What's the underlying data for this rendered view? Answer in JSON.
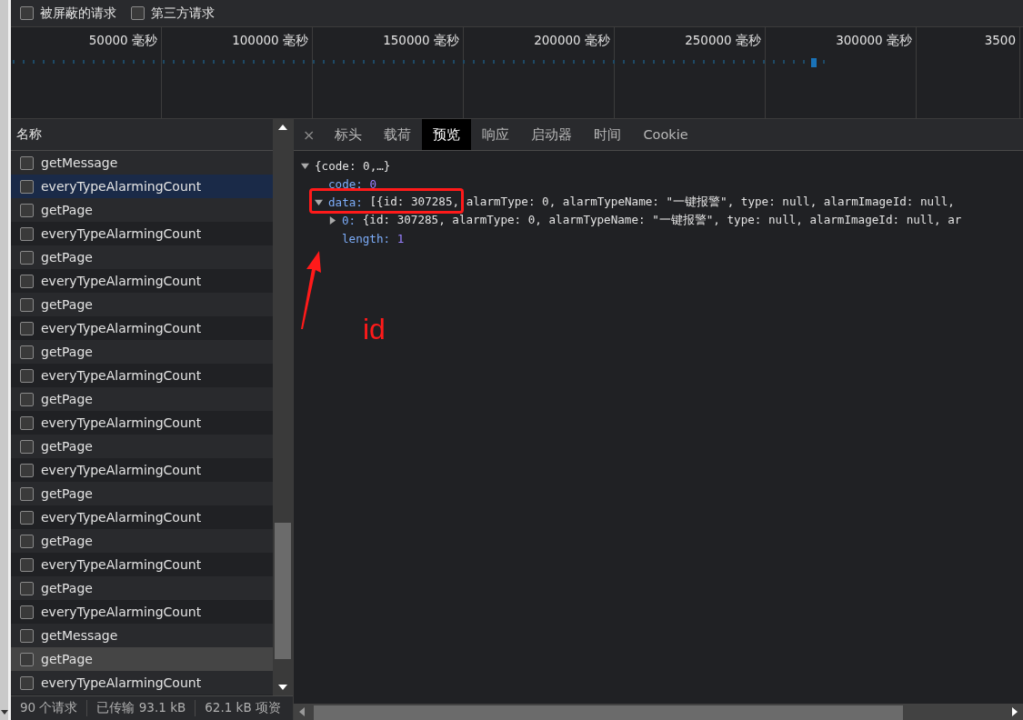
{
  "filters": [
    {
      "label": "被屏蔽的请求",
      "checked": false
    },
    {
      "label": "第三方请求",
      "checked": false
    }
  ],
  "timeline": {
    "labels": [
      "50000 毫秒",
      "100000 毫秒",
      "150000 毫秒",
      "200000 毫秒",
      "250000 毫秒",
      "300000 毫秒",
      "3500"
    ]
  },
  "requests": {
    "column": "名称",
    "rows": [
      {
        "name": "getMessage",
        "selected": false,
        "hovered": false
      },
      {
        "name": "everyTypeAlarmingCount",
        "selected": true,
        "hovered": false
      },
      {
        "name": "getPage",
        "selected": false,
        "hovered": false
      },
      {
        "name": "everyTypeAlarmingCount",
        "selected": false,
        "hovered": false
      },
      {
        "name": "getPage",
        "selected": false,
        "hovered": false
      },
      {
        "name": "everyTypeAlarmingCount",
        "selected": false,
        "hovered": false
      },
      {
        "name": "getPage",
        "selected": false,
        "hovered": false
      },
      {
        "name": "everyTypeAlarmingCount",
        "selected": false,
        "hovered": false
      },
      {
        "name": "getPage",
        "selected": false,
        "hovered": false
      },
      {
        "name": "everyTypeAlarmingCount",
        "selected": false,
        "hovered": false
      },
      {
        "name": "getPage",
        "selected": false,
        "hovered": false
      },
      {
        "name": "everyTypeAlarmingCount",
        "selected": false,
        "hovered": false
      },
      {
        "name": "getPage",
        "selected": false,
        "hovered": false
      },
      {
        "name": "everyTypeAlarmingCount",
        "selected": false,
        "hovered": false
      },
      {
        "name": "getPage",
        "selected": false,
        "hovered": false
      },
      {
        "name": "everyTypeAlarmingCount",
        "selected": false,
        "hovered": false
      },
      {
        "name": "getPage",
        "selected": false,
        "hovered": false
      },
      {
        "name": "everyTypeAlarmingCount",
        "selected": false,
        "hovered": false
      },
      {
        "name": "getPage",
        "selected": false,
        "hovered": false
      },
      {
        "name": "everyTypeAlarmingCount",
        "selected": false,
        "hovered": false
      },
      {
        "name": "getMessage",
        "selected": false,
        "hovered": false
      },
      {
        "name": "getPage",
        "selected": false,
        "hovered": true
      },
      {
        "name": "everyTypeAlarmingCount",
        "selected": false,
        "hovered": false
      }
    ]
  },
  "status_bar": [
    "90 个请求",
    "已传输 93.1 kB",
    "62.1 kB 项资"
  ],
  "detail": {
    "close": "×",
    "tabs": [
      {
        "label": "标头",
        "selected": false
      },
      {
        "label": "载荷",
        "selected": false
      },
      {
        "label": "预览",
        "selected": true
      },
      {
        "label": "响应",
        "selected": false
      },
      {
        "label": "启动器",
        "selected": false
      },
      {
        "label": "时间",
        "selected": false
      },
      {
        "label": "Cookie",
        "selected": false
      }
    ],
    "preview": {
      "summary": "{code: 0,…}",
      "expanded": true,
      "children": [
        {
          "key": "code:",
          "value": "0",
          "kind": "number"
        },
        {
          "key": "data:",
          "value": "[{id: 307285, alarmType: 0, alarmTypeName: \"一键报警\", type: null, alarmImageId: null,",
          "kind": "object",
          "expanded": true,
          "highlighted": true,
          "children": [
            {
              "key": "0:",
              "value": "{id: 307285, alarmType: 0, alarmTypeName: \"一键报警\", type: null, alarmImageId: null, ar",
              "kind": "object",
              "expanded": false
            },
            {
              "key": "length:",
              "value": "1",
              "kind": "number"
            }
          ]
        }
      ]
    },
    "annotation": {
      "label": "id"
    }
  }
}
